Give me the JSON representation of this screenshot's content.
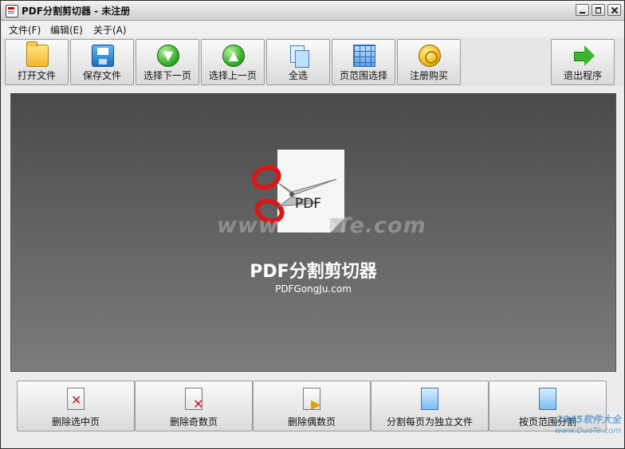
{
  "window": {
    "title": "PDF分割剪切器 - 未注册"
  },
  "menu": {
    "items": [
      "文件(F)",
      "编辑(E)",
      "关于(A)"
    ]
  },
  "toolbar": {
    "buttons": [
      {
        "label": "打开文件",
        "icon": "folder-open-icon"
      },
      {
        "label": "保存文件",
        "icon": "save-disk-icon"
      },
      {
        "label": "选择下一页",
        "icon": "down-arrow-icon"
      },
      {
        "label": "选择上一页",
        "icon": "up-arrow-icon"
      },
      {
        "label": "全选",
        "icon": "pages-icon"
      },
      {
        "label": "页范围选择",
        "icon": "grid-icon"
      },
      {
        "label": "注册购买",
        "icon": "coin-icon"
      }
    ],
    "exit": {
      "label": "退出程序",
      "icon": "exit-arrow-icon"
    }
  },
  "canvas": {
    "logo_text": "PDF",
    "watermark": "www.DuoTe.com",
    "title": "PDF分割剪切器",
    "subtitle": "PDFGongJu.com"
  },
  "bottom": {
    "buttons": [
      {
        "label": "删除选中页",
        "icon": "delete-page-icon"
      },
      {
        "label": "删除奇数页",
        "icon": "delete-odd-icon"
      },
      {
        "label": "删除偶数页",
        "icon": "delete-even-icon"
      },
      {
        "label": "分割每页为独立文件",
        "icon": "split-page-icon"
      },
      {
        "label": "按页范围分割",
        "icon": "split-range-icon"
      }
    ]
  },
  "corner_watermark": {
    "line1": "2345软件大全",
    "line2": "www.DuoTe.com"
  },
  "colors": {
    "canvas_top": "#4a4a4a",
    "canvas_bottom": "#7c7c7c",
    "scissors": "#d81818"
  }
}
